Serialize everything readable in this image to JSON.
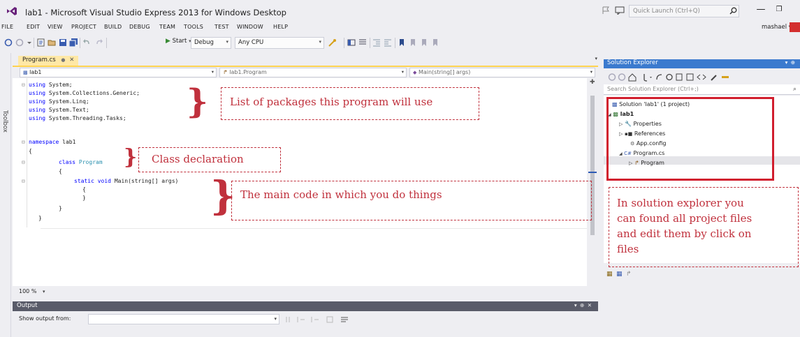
{
  "window": {
    "title": "lab1 - Microsoft Visual Studio Express 2013 for Windows Desktop",
    "quick_launch_placeholder": "Quick Launch (Ctrl+Q)",
    "user": "mashael ▾"
  },
  "menu": [
    "FILE",
    "EDIT",
    "VIEW",
    "PROJECT",
    "BUILD",
    "DEBUG",
    "TEAM",
    "TOOLS",
    "TEST",
    "WINDOW",
    "HELP"
  ],
  "toolbar": {
    "start_label": "Start",
    "config": "Debug",
    "platform": "Any CPU"
  },
  "toolbox_label": "Toolbox",
  "document_tab": {
    "label": "Program.cs"
  },
  "navbar": {
    "project": "lab1",
    "class": "lab1.Program",
    "member": "Main(string[] args)"
  },
  "code": {
    "line1_kw": "using",
    "line1_rest": " System;",
    "line2_kw": "using",
    "line2_rest": " System.Collections.Generic;",
    "line3_kw": "using",
    "line3_rest": " System.Linq;",
    "line4_kw": "using",
    "line4_rest": " System.Text;",
    "line5_kw": "using",
    "line5_rest": " System.Threading.Tasks;",
    "line7_kw": "namespace",
    "line7_rest": " lab1",
    "line8": "{",
    "line9_kw": "class",
    "line9_type": "Program",
    "line10": "{",
    "line11_kw1": "static",
    "line11_kw2": "void",
    "line11_rest": " Main(string[] args)",
    "line12": "{",
    "line13": "}",
    "line14": "}",
    "line15": "}"
  },
  "zoom": "100 %",
  "output": {
    "title": "Output",
    "show_from_label": "Show output from:"
  },
  "solution_explorer": {
    "title": "Solution Explorer",
    "search_placeholder": "Search Solution Explorer (Ctrl+;)",
    "solution": "Solution 'lab1' (1 project)",
    "project": "lab1",
    "properties": "Properties",
    "references": "References",
    "app_config": "App.config",
    "program_cs": "Program.cs",
    "program_class": "Program"
  },
  "annotations": {
    "packages": "List of packages this program  will use",
    "class_decl": "Class declaration",
    "main_code": "The main code in which you do things",
    "se_line1": "In solution explorer  you",
    "se_line2": "can found all project files",
    "se_line3": "and edit them by click on",
    "se_line4": "files"
  },
  "colors": {
    "keyword": "#0000ff",
    "type": "#2b91af",
    "annotation": "#c0303c",
    "solution_explorer_header": "#3b7ace",
    "output_header": "#595b69",
    "active_tab": "#ffe8a6"
  }
}
